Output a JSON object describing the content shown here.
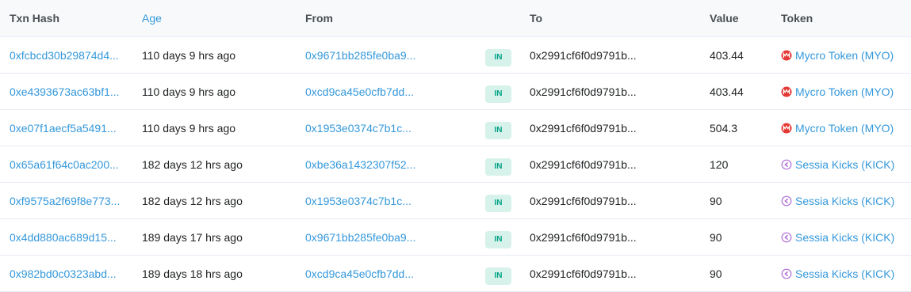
{
  "headers": {
    "hash": "Txn Hash",
    "age": "Age",
    "from": "From",
    "to": "To",
    "value": "Value",
    "token": "Token"
  },
  "rows": [
    {
      "hash": "0xfcbcd30b29874d4...",
      "age": "110 days 9 hrs ago",
      "from": "0x9671bb285fe0ba9...",
      "dir": "IN",
      "to": "0x2991cf6f0d9791b...",
      "value": "403.44",
      "token": "Mycro Token (MYO)",
      "token_icon": "mycro-token-icon"
    },
    {
      "hash": "0xe4393673ac63bf1...",
      "age": "110 days 9 hrs ago",
      "from": "0xcd9ca45e0cfb7dd...",
      "dir": "IN",
      "to": "0x2991cf6f0d9791b...",
      "value": "403.44",
      "token": "Mycro Token (MYO)",
      "token_icon": "mycro-token-icon"
    },
    {
      "hash": "0xe07f1aecf5a5491...",
      "age": "110 days 9 hrs ago",
      "from": "0x1953e0374c7b1c...",
      "dir": "IN",
      "to": "0x2991cf6f0d9791b...",
      "value": "504.3",
      "token": "Mycro Token (MYO)",
      "token_icon": "mycro-token-icon"
    },
    {
      "hash": "0x65a61f64c0ac200...",
      "age": "182 days 12 hrs ago",
      "from": "0xbe36a1432307f52...",
      "dir": "IN",
      "to": "0x2991cf6f0d9791b...",
      "value": "120",
      "token": "Sessia Kicks (KICK)",
      "token_icon": "sessia-kicks-icon"
    },
    {
      "hash": "0xf9575a2f69f8e773...",
      "age": "182 days 12 hrs ago",
      "from": "0x1953e0374c7b1c...",
      "dir": "IN",
      "to": "0x2991cf6f0d9791b...",
      "value": "90",
      "token": "Sessia Kicks (KICK)",
      "token_icon": "sessia-kicks-icon"
    },
    {
      "hash": "0x4dd880ac689d15...",
      "age": "189 days 17 hrs ago",
      "from": "0x9671bb285fe0ba9...",
      "dir": "IN",
      "to": "0x2991cf6f0d9791b...",
      "value": "90",
      "token": "Sessia Kicks (KICK)",
      "token_icon": "sessia-kicks-icon"
    },
    {
      "hash": "0x982bd0c0323abd...",
      "age": "189 days 18 hrs ago",
      "from": "0xcd9ca45e0cfb7dd...",
      "dir": "IN",
      "to": "0x2991cf6f0d9791b...",
      "value": "90",
      "token": "Sessia Kicks (KICK)",
      "token_icon": "sessia-kicks-icon"
    }
  ],
  "colors": {
    "link": "#3498db",
    "badge_bg": "#d7f2ea",
    "badge_text": "#00a186",
    "mycro": "#e53935",
    "kick": "#b06fd8"
  }
}
